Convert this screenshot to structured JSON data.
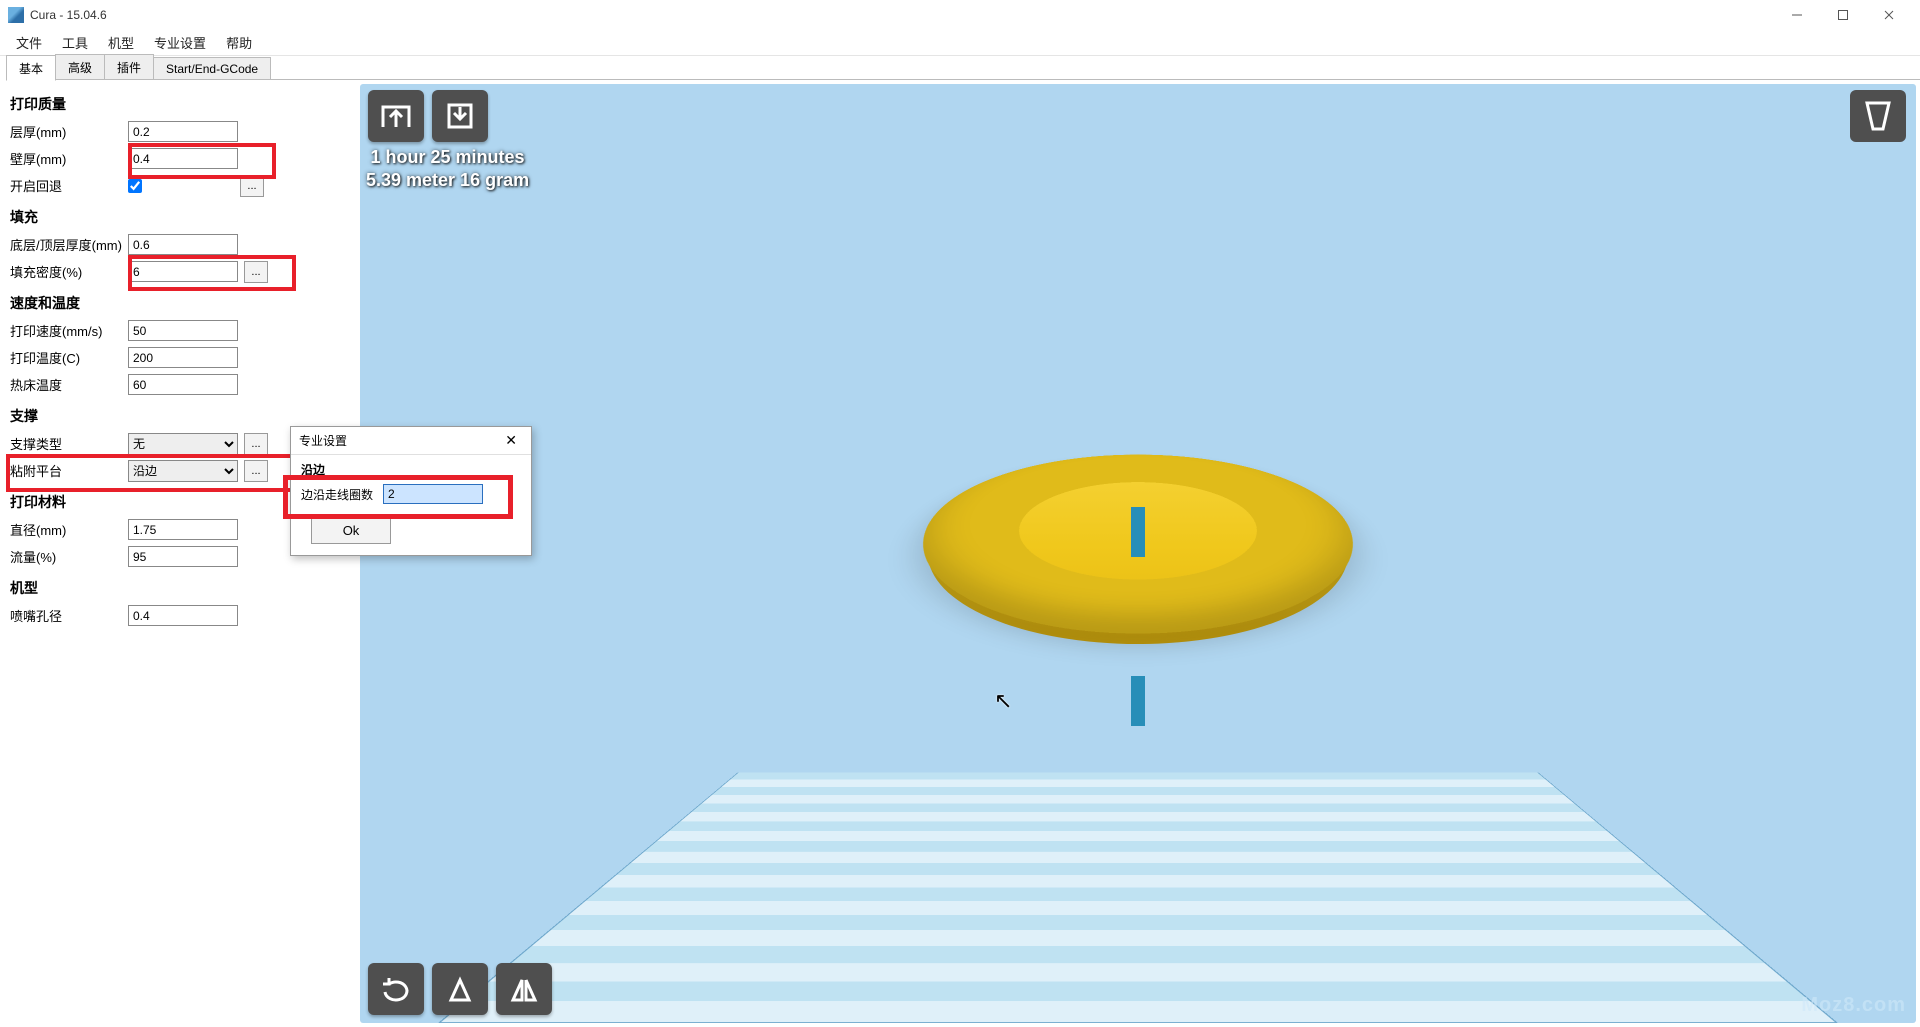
{
  "window": {
    "title": "Cura - 15.04.6"
  },
  "menu": {
    "file": "文件",
    "tools": "工具",
    "machine": "机型",
    "expert": "专业设置",
    "help": "帮助"
  },
  "tabs": {
    "basic": "基本",
    "advanced": "高级",
    "plugins": "插件",
    "gcode": "Start/End-GCode"
  },
  "quality": {
    "title": "打印质量",
    "layer_label": "层厚(mm)",
    "layer_value": "0.2",
    "wall_label": "壁厚(mm)",
    "wall_value": "0.4",
    "retract_label": "开启回退",
    "retract_checked": true,
    "retract_more": "..."
  },
  "fill": {
    "title": "填充",
    "topbot_label": "底层/顶层厚度(mm)",
    "topbot_value": "0.6",
    "density_label": "填充密度(%)",
    "density_value": "6",
    "density_more": "..."
  },
  "speed": {
    "title": "速度和温度",
    "print_label": "打印速度(mm/s)",
    "print_value": "50",
    "temp_label": "打印温度(C)",
    "temp_value": "200",
    "bed_label": "热床温度",
    "bed_value": "60"
  },
  "support": {
    "title": "支撑",
    "type_label": "支撑类型",
    "type_value": "无",
    "type_more": "...",
    "adh_label": "粘附平台",
    "adh_value": "沿边",
    "adh_more": "..."
  },
  "material": {
    "title": "打印材料",
    "diameter_label": "直径(mm)",
    "diameter_value": "1.75",
    "flow_label": "流量(%)",
    "flow_value": "95"
  },
  "machine": {
    "title": "机型",
    "nozzle_label": "喷嘴孔径",
    "nozzle_value": "0.4"
  },
  "dialog": {
    "title": "专业设置",
    "subtitle": "沿边",
    "brim_label": "边沿走线圈数",
    "brim_value": "2",
    "ok": "Ok"
  },
  "estimate": {
    "line1": "1 hour 25 minutes",
    "line2": "5.39 meter 16 gram"
  },
  "watermark": "Moz8.com"
}
